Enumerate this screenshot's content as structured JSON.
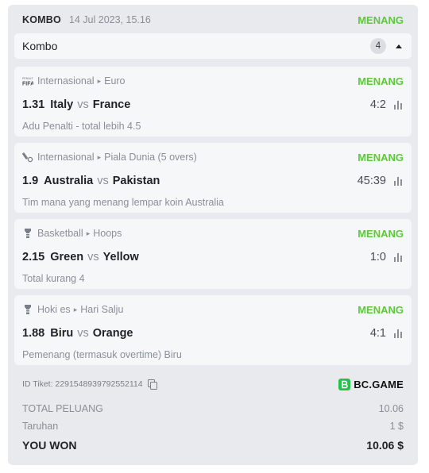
{
  "header": {
    "bet_type": "KOMBO",
    "datetime": "14 Jul 2023, 15.16",
    "status": "MENANG",
    "status_color": "#5cc93b"
  },
  "combo": {
    "label": "Kombo",
    "count": "4",
    "toggle_icon": "chevron-up-icon"
  },
  "bets": [
    {
      "sport_icon": "fifa-penalty-icon",
      "sport": "Internasional",
      "league": "Euro",
      "status": "MENANG",
      "odd": "1.31",
      "home": "Italy",
      "vs": "vs",
      "away": "France",
      "score": "4:2",
      "market": "Adu Penalti - total lebih 4.5"
    },
    {
      "sport_icon": "cricket-icon",
      "sport": "Internasional",
      "league": "Piala Dunia (5 overs)",
      "status": "MENANG",
      "odd": "1.9",
      "home": "Australia",
      "vs": "vs",
      "away": "Pakistan",
      "score": "45:39",
      "market": "Tim mana yang menang lempar koin Australia"
    },
    {
      "sport_icon": "basketball-icon",
      "sport": "Basketball",
      "league": "Hoops",
      "status": "MENANG",
      "odd": "2.15",
      "home": "Green",
      "vs": "vs",
      "away": "Yellow",
      "score": "1:0",
      "market": "Total kurang 4"
    },
    {
      "sport_icon": "ice-hockey-icon",
      "sport": "Hoki es",
      "league": "Hari Salju",
      "status": "MENANG",
      "odd": "1.88",
      "home": "Biru",
      "vs": "vs",
      "away": "Orange",
      "score": "4:1",
      "market": "Pemenang (termasuk overtime) Biru"
    }
  ],
  "footer": {
    "ticket_id": "ID Tiket: 2291548939792552114",
    "brand": "BC.GAME",
    "brand_color": "#24c24a",
    "total_odds_label": "TOTAL PELUANG",
    "total_odds_value": "10.06",
    "stake_label": "Taruhan",
    "stake_value": "1 $",
    "won_label": "YOU WON",
    "won_value": "10.06 $"
  }
}
